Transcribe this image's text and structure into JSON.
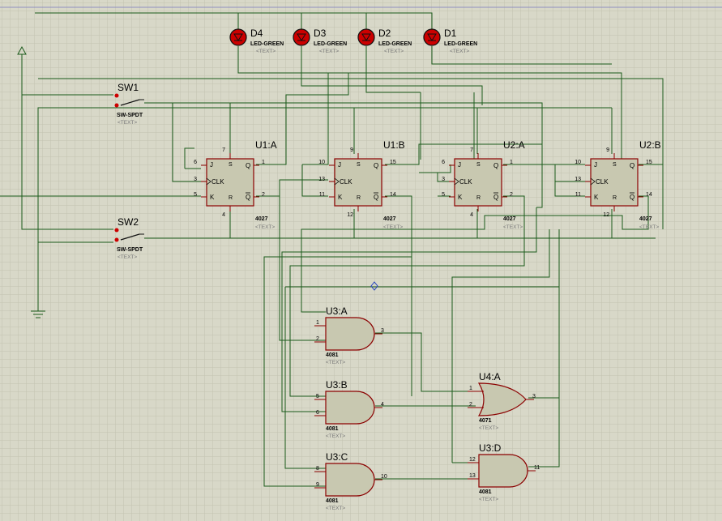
{
  "colors": {
    "background": "#d8d8c8",
    "grid": "#c2c2b0",
    "wire": "#1a5a1a",
    "component_outline": "#8b0000",
    "component_fill": "#c8c8b0",
    "led_fill": "#cc0000"
  },
  "leds": [
    {
      "ref": "D4",
      "value": "LED-GREEN",
      "text": "<TEXT>"
    },
    {
      "ref": "D3",
      "value": "LED-GREEN",
      "text": "<TEXT>"
    },
    {
      "ref": "D2",
      "value": "LED-GREEN",
      "text": "<TEXT>"
    },
    {
      "ref": "D1",
      "value": "LED-GREEN",
      "text": "<TEXT>"
    }
  ],
  "switches": [
    {
      "ref": "SW1",
      "value": "SW-SPDT",
      "text": "<TEXT>"
    },
    {
      "ref": "SW2",
      "value": "SW-SPDT",
      "text": "<TEXT>"
    }
  ],
  "flipflops": [
    {
      "ref": "U1:A",
      "part": "4027",
      "text": "<TEXT>",
      "pins": {
        "j": "6",
        "clk": "3",
        "k": "5",
        "q": "1",
        "qbar": "2",
        "s": "7",
        "r": "4"
      }
    },
    {
      "ref": "U1:B",
      "part": "4027",
      "text": "<TEXT>",
      "pins": {
        "j": "10",
        "clk": "13",
        "k": "11",
        "q": "15",
        "qbar": "14",
        "s": "9",
        "r": "12"
      }
    },
    {
      "ref": "U2:A",
      "part": "4027",
      "text": "<TEXT>",
      "pins": {
        "j": "6",
        "clk": "3",
        "k": "5",
        "q": "1",
        "qbar": "2",
        "s": "7",
        "r": "4"
      }
    },
    {
      "ref": "U2:B",
      "part": "4027",
      "text": "<TEXT>",
      "pins": {
        "j": "10",
        "clk": "13",
        "k": "11",
        "q": "15",
        "qbar": "14",
        "s": "9",
        "r": "12"
      }
    }
  ],
  "ff_labels": {
    "j": "J",
    "clk": "CLK",
    "k": "K",
    "q": "Q",
    "qbar": "Q",
    "s": "S",
    "r": "R"
  },
  "gates": [
    {
      "ref": "U3:A",
      "part": "4081",
      "text": "<TEXT>",
      "type": "and",
      "in1": "1",
      "in2": "2",
      "out": "3"
    },
    {
      "ref": "U3:B",
      "part": "4081",
      "text": "<TEXT>",
      "type": "and",
      "in1": "5",
      "in2": "6",
      "out": "4"
    },
    {
      "ref": "U3:C",
      "part": "4081",
      "text": "<TEXT>",
      "type": "and",
      "in1": "8",
      "in2": "9",
      "out": "10"
    },
    {
      "ref": "U4:A",
      "part": "4071",
      "text": "<TEXT>",
      "type": "or",
      "in1": "1",
      "in2": "2",
      "out": "3"
    },
    {
      "ref": "U3:D",
      "part": "4081",
      "text": "<TEXT>",
      "type": "and",
      "in1": "12",
      "in2": "13",
      "out": "11"
    }
  ]
}
